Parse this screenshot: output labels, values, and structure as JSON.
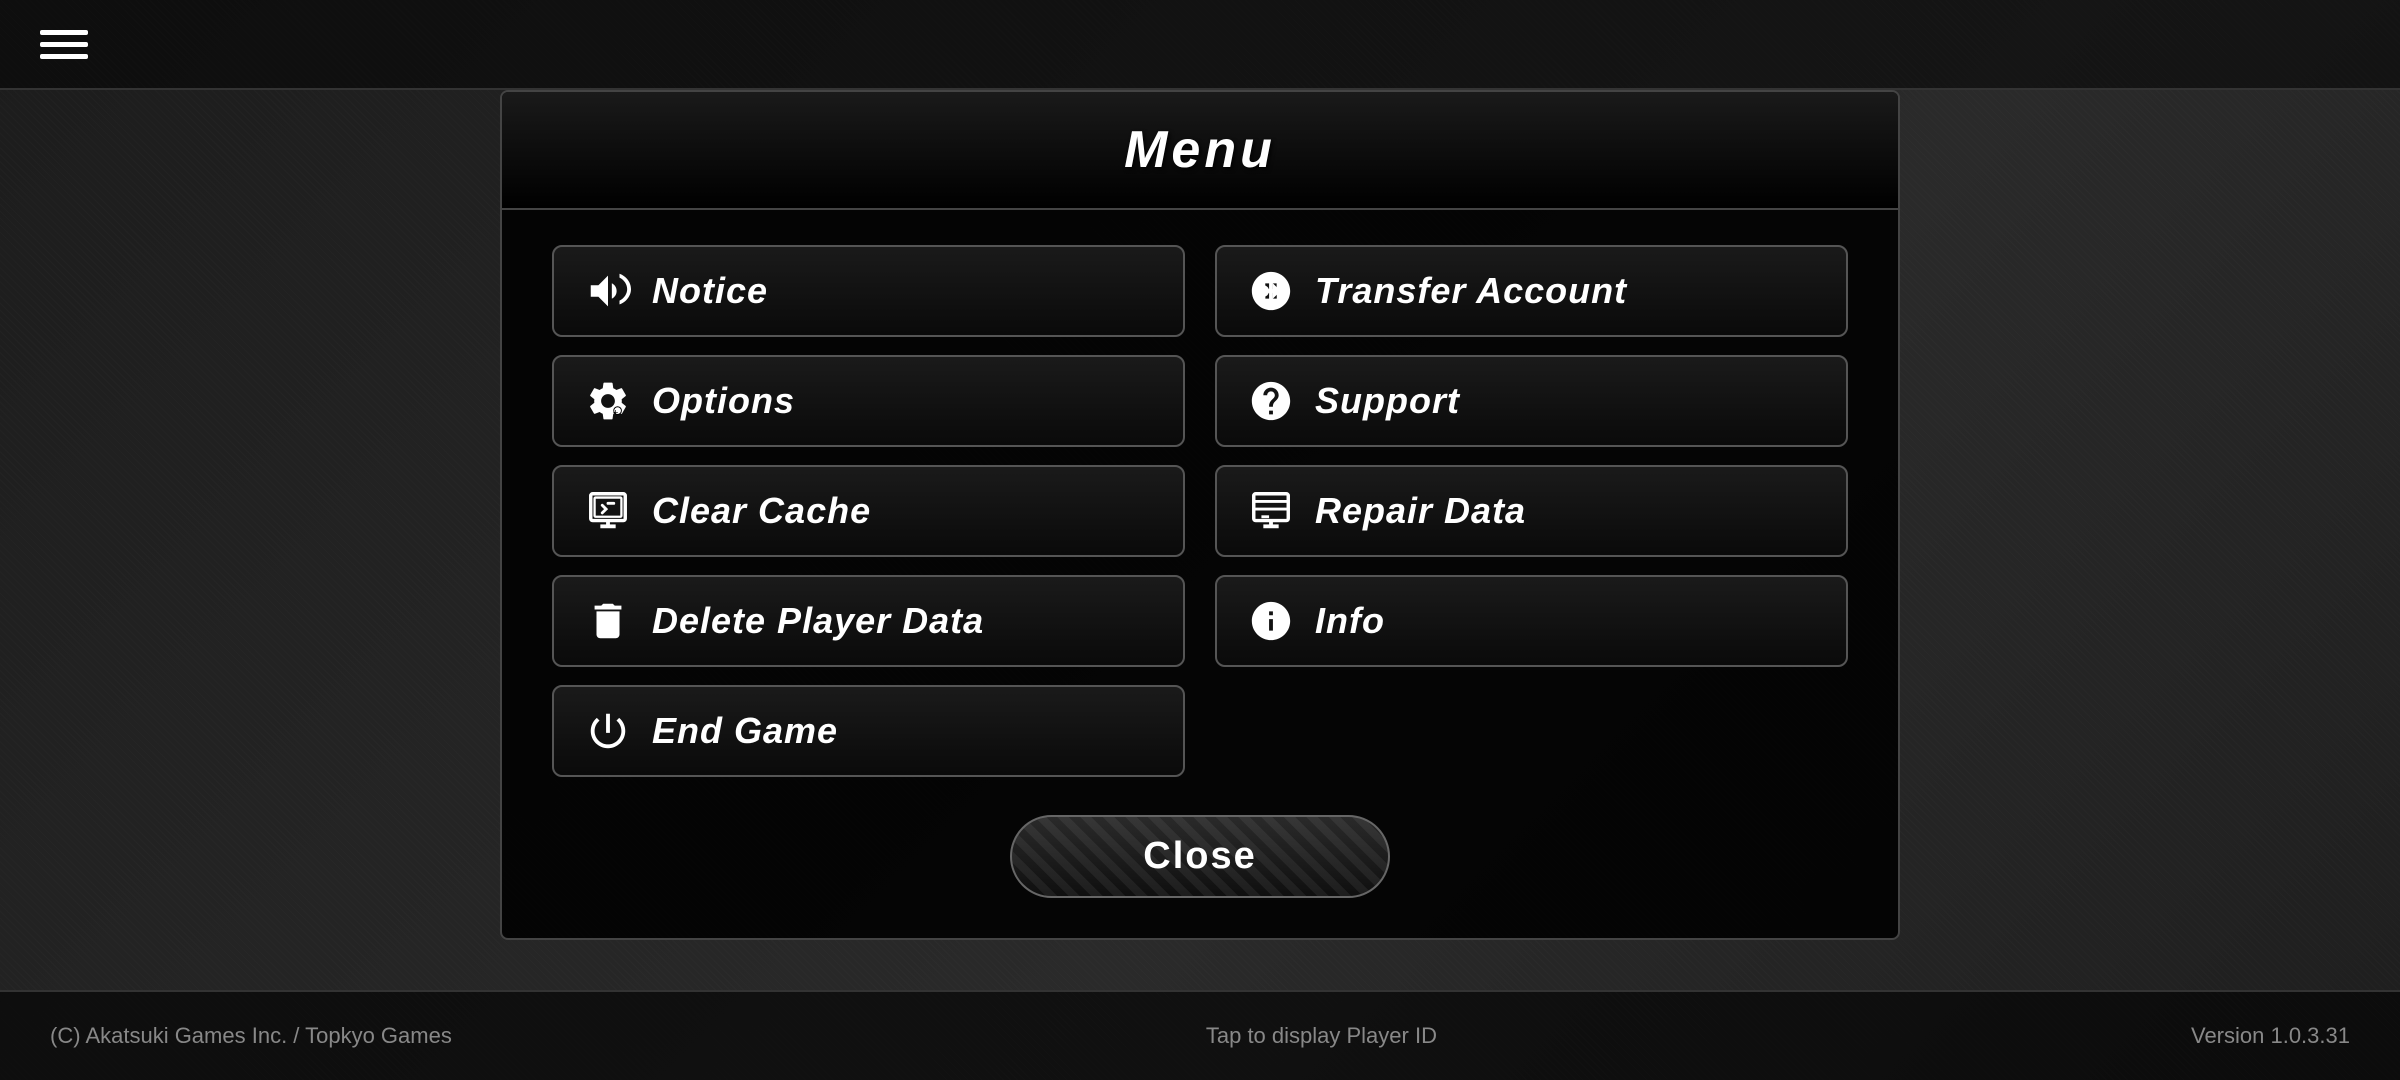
{
  "app": {
    "title": "Menu",
    "version": "Version 1.0.3.31",
    "copyright": "(C) Akatsuki Games Inc. / Topkyo Games",
    "player_id_tap": "Tap to display Player ID"
  },
  "menu": {
    "title": "Menu",
    "buttons": [
      {
        "id": "notice",
        "label": "Notice",
        "icon": "megaphone",
        "col": 1
      },
      {
        "id": "transfer-account",
        "label": "Transfer Account",
        "icon": "transfer",
        "col": 2
      },
      {
        "id": "options",
        "label": "Options",
        "icon": "gear",
        "col": 1
      },
      {
        "id": "support",
        "label": "Support",
        "icon": "question",
        "col": 2
      },
      {
        "id": "clear-cache",
        "label": "Clear Cache",
        "icon": "clear-cache",
        "col": 1
      },
      {
        "id": "repair-data",
        "label": "Repair Data",
        "icon": "repair",
        "col": 2
      },
      {
        "id": "delete-player-data",
        "label": "Delete Player Data",
        "icon": "trash",
        "col": 1
      },
      {
        "id": "info",
        "label": "Info",
        "icon": "info",
        "col": 2
      },
      {
        "id": "end-game",
        "label": "End Game",
        "icon": "power",
        "col": 1
      }
    ],
    "close_label": "Close"
  },
  "topbar": {
    "hamburger_label": "Menu toggle"
  }
}
